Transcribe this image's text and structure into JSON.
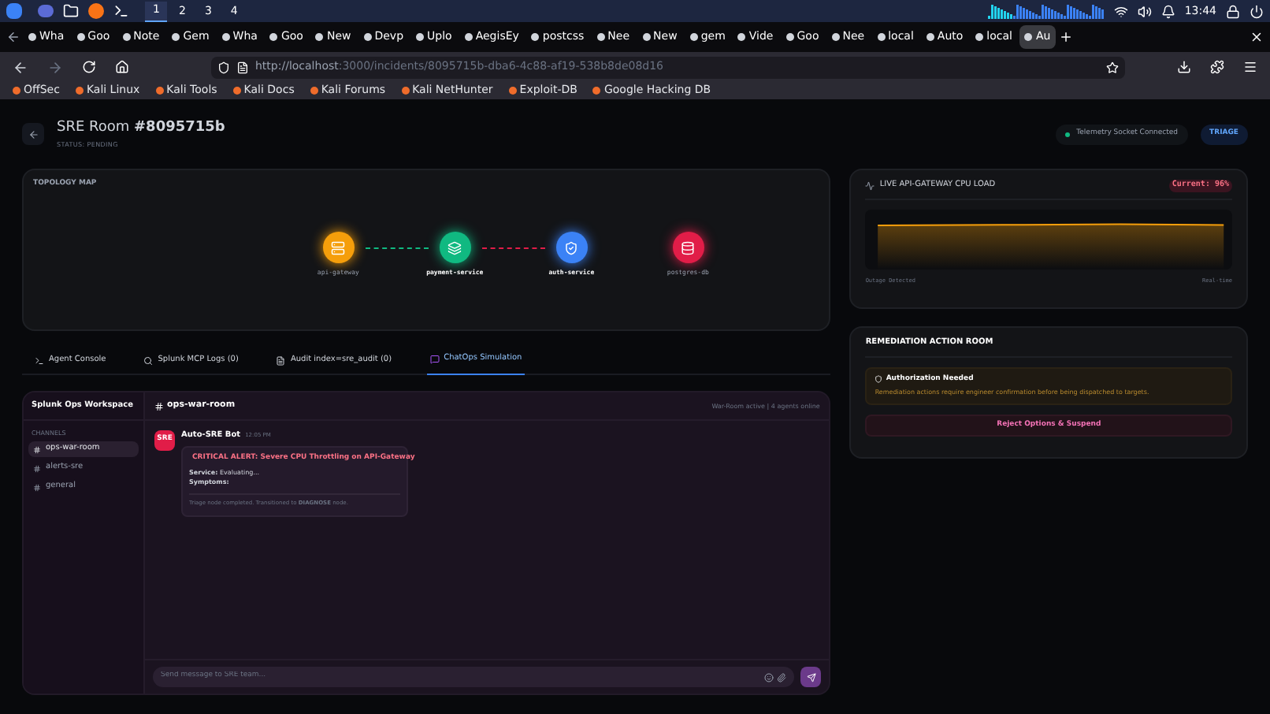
{
  "taskbar": {
    "workspaces": [
      {
        "label": "1",
        "selected": true
      },
      {
        "label": "2",
        "selected": false
      },
      {
        "label": "3",
        "selected": false
      },
      {
        "label": "4",
        "selected": false
      }
    ],
    "clock": "13:44"
  },
  "browser_tabs": [
    {
      "label": "Wha",
      "selected": false
    },
    {
      "label": "Goo",
      "selected": false
    },
    {
      "label": "Note",
      "selected": false
    },
    {
      "label": "Gem",
      "selected": false
    },
    {
      "label": "Wha",
      "selected": false
    },
    {
      "label": "Goo",
      "selected": false
    },
    {
      "label": "New",
      "selected": false
    },
    {
      "label": "Devp",
      "selected": false
    },
    {
      "label": "Uplo",
      "selected": false
    },
    {
      "label": "AegisEy",
      "selected": false
    },
    {
      "label": "postcss",
      "selected": false
    },
    {
      "label": "Nee",
      "selected": false
    },
    {
      "label": "New",
      "selected": false
    },
    {
      "label": "gem",
      "selected": false
    },
    {
      "label": "Vide",
      "selected": false
    },
    {
      "label": "Goo",
      "selected": false
    },
    {
      "label": "Nee",
      "selected": false
    },
    {
      "label": "local",
      "selected": false
    },
    {
      "label": "Auto",
      "selected": false
    },
    {
      "label": "local",
      "selected": false
    },
    {
      "label": "Au",
      "selected": true
    }
  ],
  "url": {
    "host": "http://localhost",
    "path": ":3000/incidents/8095715b-dba6-4c88-af19-538b8de08d16"
  },
  "bookmarks": [
    "OffSec",
    "Kali Linux",
    "Kali Tools",
    "Kali Docs",
    "Kali Forums",
    "Kali NetHunter",
    "Exploit-DB",
    "Google Hacking DB"
  ],
  "header": {
    "title": "SRE Room **#8095715b**",
    "status": "STATUS: PENDING",
    "socket": "Telemetry Socket Connected",
    "stage": "TRIAGE"
  },
  "topology": {
    "title": "TOPOLOGY MAP",
    "nodes": [
      {
        "label": "api-gateway",
        "color": "#f59e0b",
        "bold": false
      },
      {
        "label": "payment-service",
        "color": "#10b981",
        "bold": true
      },
      {
        "label": "auth-service",
        "color": "#3b82f6",
        "bold": true
      },
      {
        "label": "postgres-db",
        "color": "#e11d48",
        "bold": false
      }
    ]
  },
  "tabs": [
    {
      "label": "Agent Console",
      "selected": false
    },
    {
      "label": "Splunk MCP Logs (0)",
      "selected": false
    },
    {
      "label": "Audit index=sre_audit (0)",
      "selected": false
    },
    {
      "label": "ChatOps Simulation",
      "selected": true
    }
  ],
  "chat": {
    "workspace": "Splunk Ops Workspace",
    "channels_heading": "CHANNELS",
    "channels": [
      {
        "label": "ops-war-room",
        "selected": true
      },
      {
        "label": "alerts-sre",
        "selected": false
      },
      {
        "label": "general",
        "selected": false
      }
    ],
    "room": "ops-war-room",
    "presence": "War-Room active | 4 agents online",
    "messages": [
      {
        "avatar": "SRE",
        "author": "Auto-SRE Bot",
        "time": "12:05 PM",
        "alert": "CRITICAL ALERT: Severe CPU Throttling on API-Gateway",
        "lines": [
          "**Service:** Evaluating...",
          "**Symptoms:**"
        ],
        "footer": "Triage node completed. Transitioned to **DIAGNOSE** node."
      }
    ],
    "composer": {
      "placeholder": "Send message to SRE team..."
    }
  },
  "cpu": {
    "title": "LIVE API-GATEWAY CPU LOAD",
    "current": "Current: 96%",
    "left_caption": "Outage Detected",
    "right_caption": "Real-time"
  },
  "remediation": {
    "title": "REMEDIATION ACTION ROOM",
    "notice_title": "Authorization Needed",
    "notice": "Remediation actions require engineer confirmation before being dispatched to targets.",
    "reject": "Reject Options & Suspend"
  }
}
